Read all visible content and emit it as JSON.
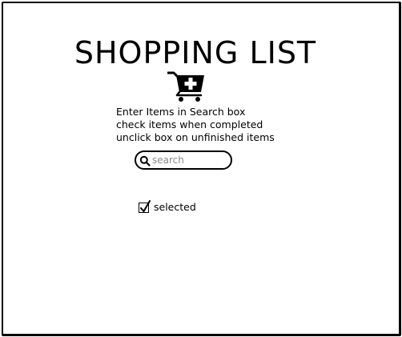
{
  "header": {
    "title": "SHOPPING LIST",
    "cart_icon": "cart-add-icon"
  },
  "instructions": [
    "Enter Items in Search box",
    "check items when completed",
    "unclick box on unfinished items"
  ],
  "search": {
    "placeholder": "search",
    "value": "",
    "icon": "search-icon"
  },
  "items": [
    {
      "label": "selected",
      "checked": true
    }
  ]
}
